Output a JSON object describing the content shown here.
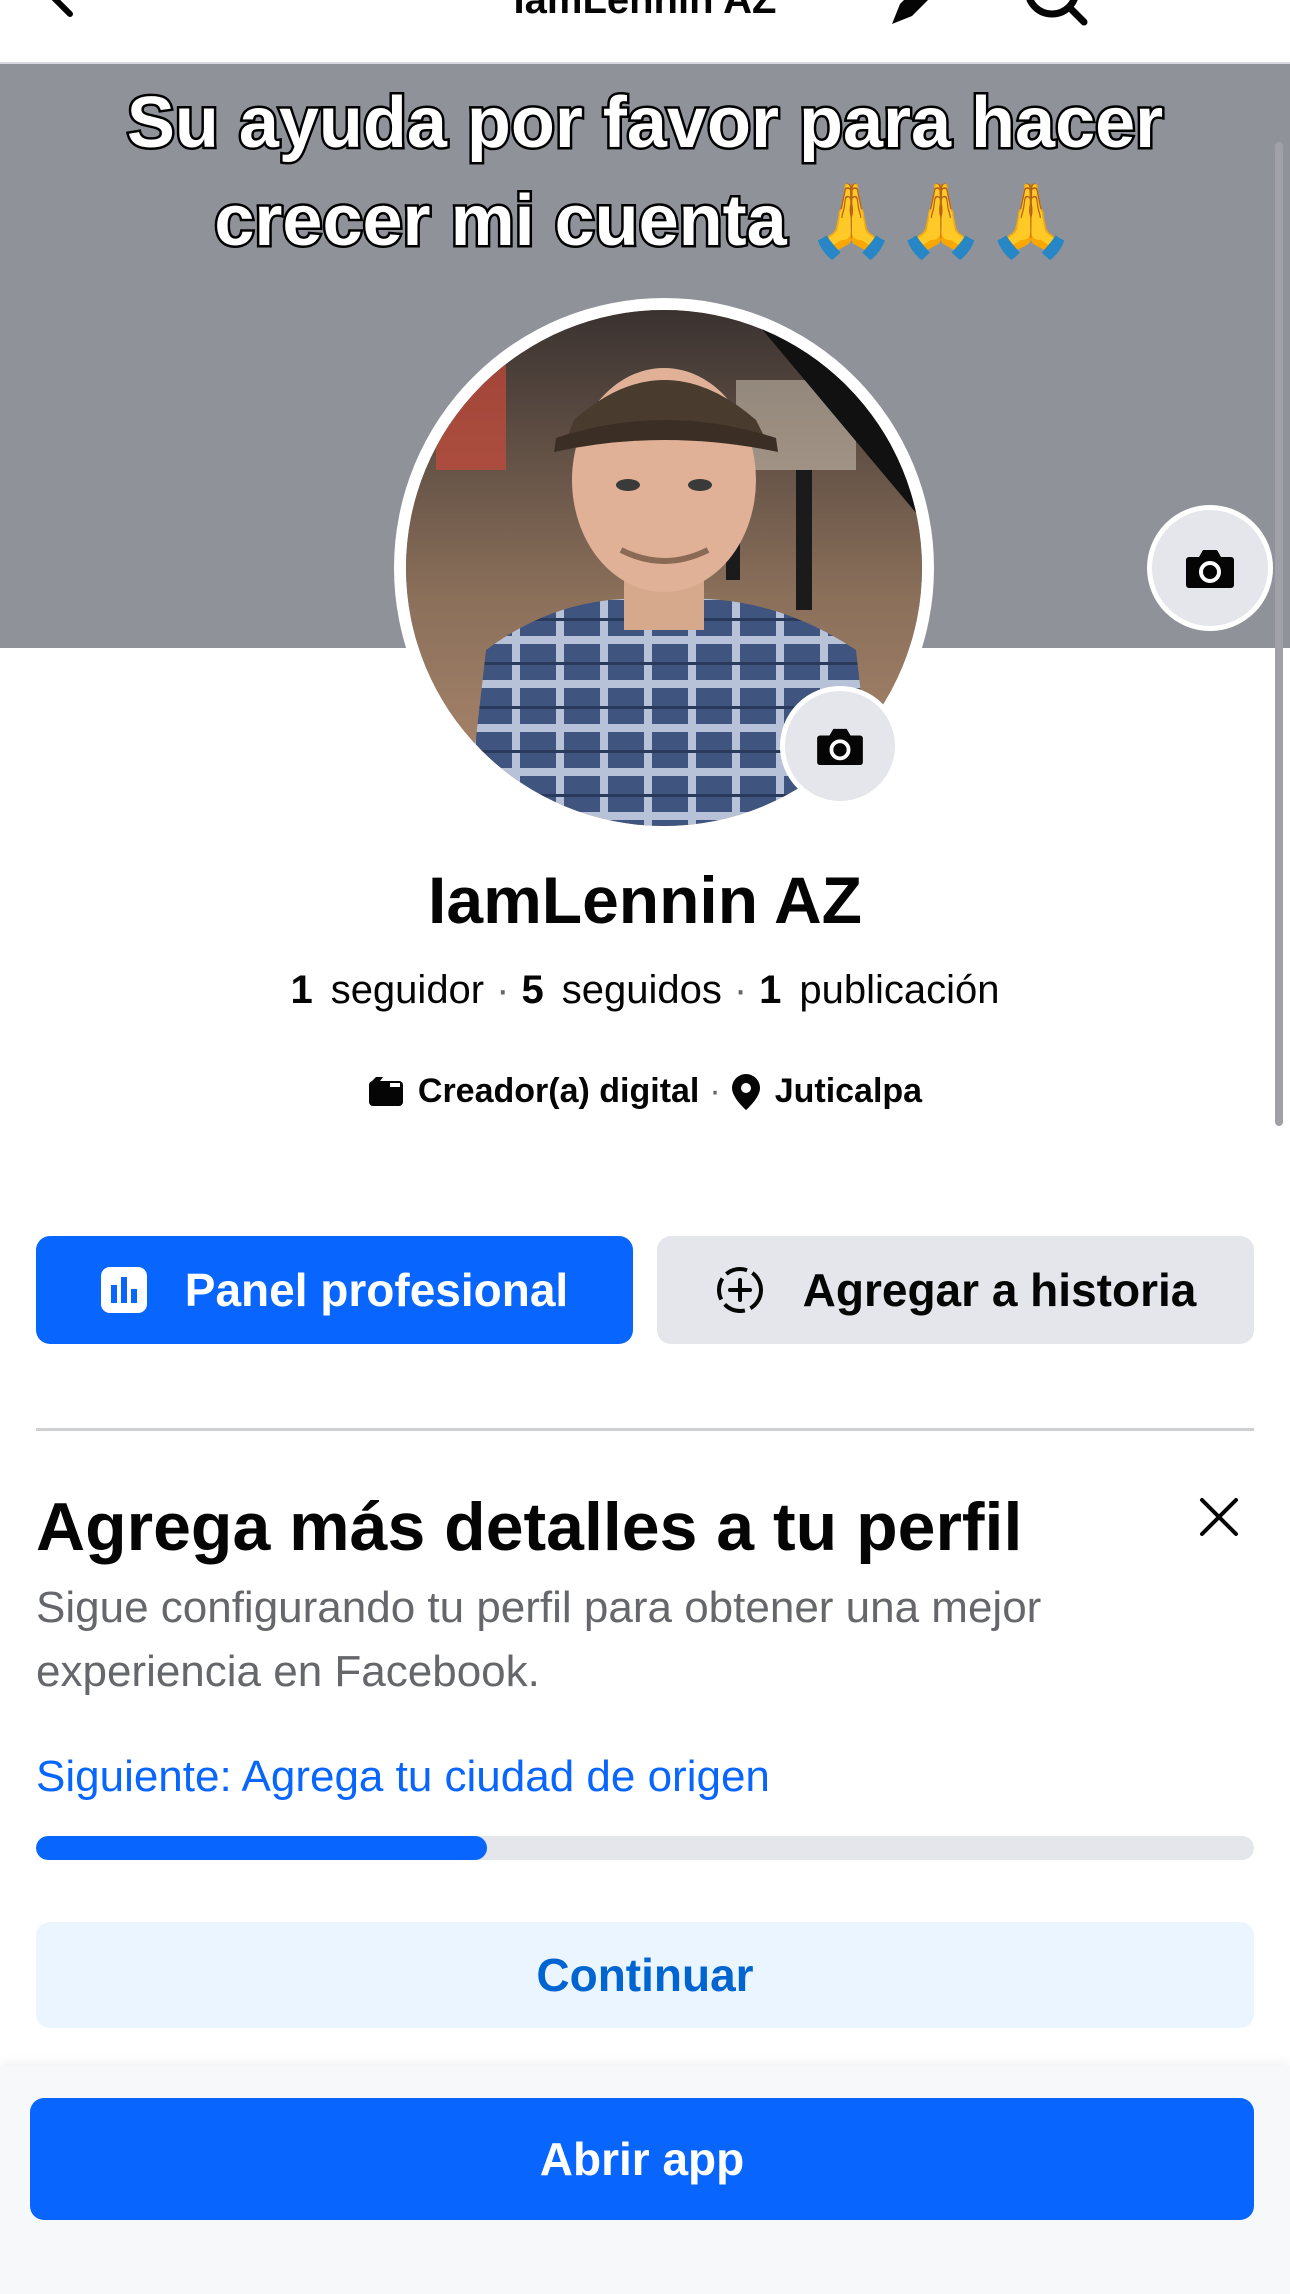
{
  "header": {
    "title": "IamLennin AZ"
  },
  "cover": {
    "caption": "Su ayuda por favor para hacer crecer mi cuenta",
    "caption_emoji": "🙏🙏🙏"
  },
  "profile": {
    "name": "IamLennin AZ",
    "stats": {
      "followers_count": "1",
      "followers_label": "seguidor",
      "following_count": "5",
      "following_label": "seguidos",
      "posts_count": "1",
      "posts_label": "publicación"
    },
    "category": "Creador(a) digital",
    "location": "Juticalpa"
  },
  "actions": {
    "primary_label": "Panel profesional",
    "secondary_label": "Agregar a historia"
  },
  "setup_card": {
    "title": "Agrega más detalles a tu perfil",
    "description": "Sigue configurando tu perfil para obtener una mejor experiencia en Facebook.",
    "next_step": "Siguiente: Agrega tu ciudad de origen",
    "progress": 0.37,
    "continue_label": "Continuar"
  },
  "footer": {
    "open_app_label": "Abrir app"
  },
  "colors": {
    "accent": "#0866ff",
    "cover_bg": "#8f9399",
    "secondary_bg": "#e4e6eb",
    "link": "#0866ff"
  },
  "icons": [
    "back-arrow-icon",
    "edit-pencil-icon",
    "search-icon",
    "camera-icon",
    "briefcase-icon",
    "location-pin-icon",
    "dashboard-icon",
    "add-story-icon",
    "close-icon"
  ]
}
